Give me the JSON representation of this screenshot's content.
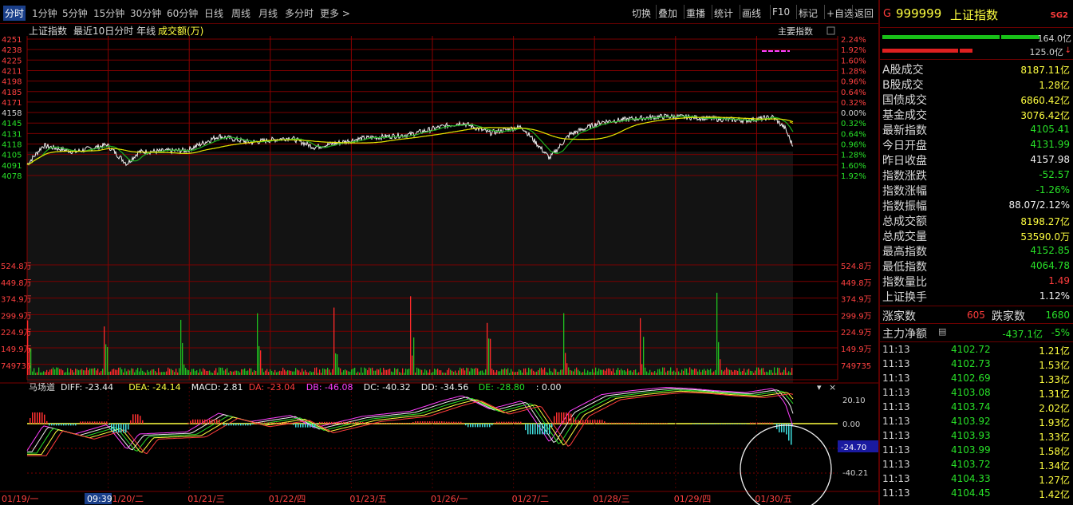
{
  "toolbar": {
    "tabs": [
      "分时",
      "1分钟",
      "5分钟",
      "15分钟",
      "30分钟",
      "60分钟",
      "日线",
      "周线",
      "月线",
      "多分时",
      "更多 >"
    ],
    "right_buttons": [
      "切换",
      "叠加",
      "重播",
      "统计",
      "画线",
      "F10",
      "标记",
      "+自选",
      "返回"
    ]
  },
  "chart": {
    "header_name": "上证指数",
    "header_range": "最近10日分时 年线",
    "header_volume": "成交额(万)",
    "main_index_label": "主要指数",
    "price_ticks_left": [
      "4251",
      "4238",
      "4225",
      "4211",
      "4198",
      "4185",
      "4171",
      "4158",
      "4145",
      "4131",
      "4118",
      "4105",
      "4091",
      "4078"
    ],
    "pct_ticks_right": [
      "2.24%",
      "1.92%",
      "1.60%",
      "1.28%",
      "0.96%",
      "0.64%",
      "0.32%",
      "0.00%",
      "0.32%",
      "0.64%",
      "0.96%",
      "1.28%",
      "1.60%",
      "1.92%"
    ],
    "vol_ticks_left": [
      "524.8万",
      "449.8万",
      "374.9万",
      "299.9万",
      "224.9万",
      "149.9万",
      "749735"
    ],
    "vol_ticks_right": [
      "524.8万",
      "449.8万",
      "374.9万",
      "299.9万",
      "224.9万",
      "149.9万",
      "749735"
    ],
    "indicator_line": {
      "name": "马场道",
      "items": [
        {
          "label": "DIFF",
          "value": "-23.44",
          "color": "#f0f0f0"
        },
        {
          "label": "DEA",
          "value": "-24.14",
          "color": "#ffff40"
        },
        {
          "label": "MACD",
          "value": "2.81",
          "color": "#f0f0f0"
        },
        {
          "label": "DA",
          "value": "-23.04",
          "color": "#ff3c3c"
        },
        {
          "label": "DB",
          "value": "-46.08",
          "color": "#ff40ff"
        },
        {
          "label": "DC",
          "value": "-40.32",
          "color": "#f0f0f0"
        },
        {
          "label": "DD",
          "value": "-34.56",
          "color": "#f0f0f0"
        },
        {
          "label": "DE",
          "value": "-28.80",
          "color": "#28e028"
        },
        {
          "label": "",
          "value": "0.00",
          "color": "#f0f0f0"
        }
      ]
    },
    "macd_ticks": [
      "20.10",
      "0.00",
      "-40.21"
    ],
    "macd_current": "-24.70",
    "cursor_time": "09:39",
    "dates": [
      "01/19/一",
      "01/20/二",
      "01/21/三",
      "01/22/四",
      "01/23/五",
      "01/26/一",
      "01/27/二",
      "01/28/三",
      "01/29/四",
      "01/30/五"
    ]
  },
  "quote": {
    "market_mark": "G",
    "code": "999999",
    "name": "上证指数",
    "badge": "SG2",
    "up_amount": "164.0亿",
    "down_amount": "125.0亿",
    "stats": [
      {
        "label": "A股成交",
        "value": "8187.11亿",
        "color": "yellow"
      },
      {
        "label": "B股成交",
        "value": "1.28亿",
        "color": "yellow"
      },
      {
        "label": "国债成交",
        "value": "6860.42亿",
        "color": "yellow"
      },
      {
        "label": "基金成交",
        "value": "3076.42亿",
        "color": "yellow"
      },
      {
        "label": "最新指数",
        "value": "4105.41",
        "color": "green"
      },
      {
        "label": "今日开盘",
        "value": "4131.99",
        "color": "green"
      },
      {
        "label": "昨日收盘",
        "value": "4157.98",
        "color": "white"
      },
      {
        "label": "指数涨跌",
        "value": "-52.57",
        "color": "green"
      },
      {
        "label": "指数涨幅",
        "value": "-1.26%",
        "color": "green"
      },
      {
        "label": "指数振幅",
        "value": "88.07/2.12%",
        "color": "white"
      },
      {
        "label": "总成交额",
        "value": "8198.27亿",
        "color": "yellow"
      },
      {
        "label": "总成交量",
        "value": "53590.0万",
        "color": "yellow"
      },
      {
        "label": "最高指数",
        "value": "4152.85",
        "color": "green"
      },
      {
        "label": "最低指数",
        "value": "4064.78",
        "color": "green"
      },
      {
        "label": "指数量比",
        "value": "1.49",
        "color": "red"
      },
      {
        "label": "上证换手",
        "value": "1.12%",
        "color": "white"
      }
    ],
    "breadth": {
      "up_label": "涨家数",
      "up_count": "605",
      "down_label": "跌家数",
      "down_count": "1680"
    },
    "flow": {
      "label": "主力净额",
      "amount": "-437.1亿",
      "pct": "-5%"
    },
    "ticks": [
      {
        "time": "11:13",
        "price": "4102.72",
        "amount": "1.21亿"
      },
      {
        "time": "11:13",
        "price": "4102.73",
        "amount": "1.53亿"
      },
      {
        "time": "11:13",
        "price": "4102.69",
        "amount": "1.33亿"
      },
      {
        "time": "11:13",
        "price": "4103.08",
        "amount": "1.31亿"
      },
      {
        "time": "11:13",
        "price": "4103.74",
        "amount": "2.02亿"
      },
      {
        "time": "11:13",
        "price": "4103.92",
        "amount": "1.93亿"
      },
      {
        "time": "11:13",
        "price": "4103.93",
        "amount": "1.33亿"
      },
      {
        "time": "11:13",
        "price": "4103.99",
        "amount": "1.58亿"
      },
      {
        "time": "11:13",
        "price": "4103.72",
        "amount": "1.34亿"
      },
      {
        "time": "11:13",
        "price": "4104.33",
        "amount": "1.27亿"
      },
      {
        "time": "11:13",
        "price": "4104.45",
        "amount": "1.42亿"
      }
    ]
  }
}
